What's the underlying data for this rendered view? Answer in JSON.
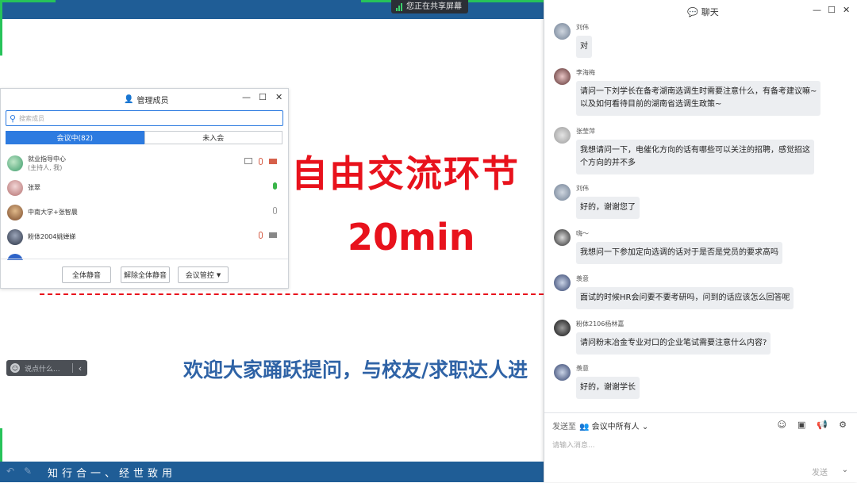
{
  "share_badge": "您正在共享屏幕",
  "slide": {
    "title": "自由交流环节",
    "time": "20min",
    "welcome": "欢迎大家踊跃提问，与校友/求职达人进",
    "motto": "知行合一、经世致用",
    "comment_placeholder": "说点什么..."
  },
  "members": {
    "title": "管理成员",
    "search_placeholder": "搜索成员",
    "tab_in": "会议中(82)",
    "tab_out": "未入会",
    "rows": [
      {
        "name": "就业指导中心",
        "sub": "(主持人, 我)"
      },
      {
        "name": "张翠",
        "sub": ""
      },
      {
        "name": "中南大学+张智晨",
        "sub": ""
      },
      {
        "name": "粉体2004姚婵娣",
        "sub": ""
      },
      {
        "name": "",
        "sub": ""
      }
    ],
    "btn_mute_all": "全体静音",
    "btn_unmute_all": "解除全体静音",
    "btn_control": "会议管控"
  },
  "chat": {
    "title": "聊天",
    "messages": [
      {
        "sender": "刘伟",
        "lines": [
          "对"
        ]
      },
      {
        "sender": "李海梅",
        "lines": [
          "请问一下刘学长在备考湖南选调生时需要注意什么，有备考建议嘛~",
          "以及如何看待目前的湖南省选调生政策~"
        ]
      },
      {
        "sender": "张莹萍",
        "lines": [
          "我想请问一下，电催化方向的话有哪些可以关注的招聘，感觉招这",
          "个方向的并不多"
        ]
      },
      {
        "sender": "刘伟",
        "lines": [
          "好的，谢谢您了"
        ]
      },
      {
        "sender": "嗨～",
        "lines": [
          "我想问一下参加定向选调的话对于是否是党员的要求高吗"
        ]
      },
      {
        "sender": "羡意",
        "lines": [
          "面试的时候HR会问要不要考研吗，问到的话应该怎么回答呢"
        ]
      },
      {
        "sender": "粉体2106杨林嘉",
        "lines": [
          "请问粉末冶金专业对口的企业笔试需要注意什么内容?"
        ]
      },
      {
        "sender": "羡意",
        "lines": [
          "好的，谢谢学长"
        ]
      }
    ],
    "send_to_label": "发送至",
    "send_to_target": "会议中所有人",
    "input_placeholder": "请输入消息...",
    "send_label": "发送"
  }
}
